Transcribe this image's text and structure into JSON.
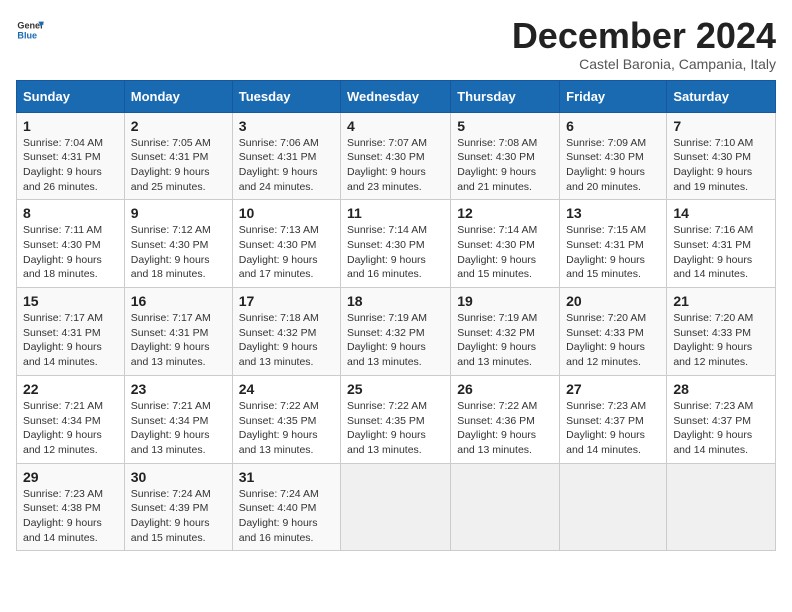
{
  "logo": {
    "line1": "General",
    "line2": "Blue"
  },
  "title": "December 2024",
  "subtitle": "Castel Baronia, Campania, Italy",
  "days_of_week": [
    "Sunday",
    "Monday",
    "Tuesday",
    "Wednesday",
    "Thursday",
    "Friday",
    "Saturday"
  ],
  "weeks": [
    [
      {
        "day": "1",
        "info": "Sunrise: 7:04 AM\nSunset: 4:31 PM\nDaylight: 9 hours\nand 26 minutes."
      },
      {
        "day": "2",
        "info": "Sunrise: 7:05 AM\nSunset: 4:31 PM\nDaylight: 9 hours\nand 25 minutes."
      },
      {
        "day": "3",
        "info": "Sunrise: 7:06 AM\nSunset: 4:31 PM\nDaylight: 9 hours\nand 24 minutes."
      },
      {
        "day": "4",
        "info": "Sunrise: 7:07 AM\nSunset: 4:30 PM\nDaylight: 9 hours\nand 23 minutes."
      },
      {
        "day": "5",
        "info": "Sunrise: 7:08 AM\nSunset: 4:30 PM\nDaylight: 9 hours\nand 21 minutes."
      },
      {
        "day": "6",
        "info": "Sunrise: 7:09 AM\nSunset: 4:30 PM\nDaylight: 9 hours\nand 20 minutes."
      },
      {
        "day": "7",
        "info": "Sunrise: 7:10 AM\nSunset: 4:30 PM\nDaylight: 9 hours\nand 19 minutes."
      }
    ],
    [
      {
        "day": "8",
        "info": "Sunrise: 7:11 AM\nSunset: 4:30 PM\nDaylight: 9 hours\nand 18 minutes."
      },
      {
        "day": "9",
        "info": "Sunrise: 7:12 AM\nSunset: 4:30 PM\nDaylight: 9 hours\nand 18 minutes."
      },
      {
        "day": "10",
        "info": "Sunrise: 7:13 AM\nSunset: 4:30 PM\nDaylight: 9 hours\nand 17 minutes."
      },
      {
        "day": "11",
        "info": "Sunrise: 7:14 AM\nSunset: 4:30 PM\nDaylight: 9 hours\nand 16 minutes."
      },
      {
        "day": "12",
        "info": "Sunrise: 7:14 AM\nSunset: 4:30 PM\nDaylight: 9 hours\nand 15 minutes."
      },
      {
        "day": "13",
        "info": "Sunrise: 7:15 AM\nSunset: 4:31 PM\nDaylight: 9 hours\nand 15 minutes."
      },
      {
        "day": "14",
        "info": "Sunrise: 7:16 AM\nSunset: 4:31 PM\nDaylight: 9 hours\nand 14 minutes."
      }
    ],
    [
      {
        "day": "15",
        "info": "Sunrise: 7:17 AM\nSunset: 4:31 PM\nDaylight: 9 hours\nand 14 minutes."
      },
      {
        "day": "16",
        "info": "Sunrise: 7:17 AM\nSunset: 4:31 PM\nDaylight: 9 hours\nand 13 minutes."
      },
      {
        "day": "17",
        "info": "Sunrise: 7:18 AM\nSunset: 4:32 PM\nDaylight: 9 hours\nand 13 minutes."
      },
      {
        "day": "18",
        "info": "Sunrise: 7:19 AM\nSunset: 4:32 PM\nDaylight: 9 hours\nand 13 minutes."
      },
      {
        "day": "19",
        "info": "Sunrise: 7:19 AM\nSunset: 4:32 PM\nDaylight: 9 hours\nand 13 minutes."
      },
      {
        "day": "20",
        "info": "Sunrise: 7:20 AM\nSunset: 4:33 PM\nDaylight: 9 hours\nand 12 minutes."
      },
      {
        "day": "21",
        "info": "Sunrise: 7:20 AM\nSunset: 4:33 PM\nDaylight: 9 hours\nand 12 minutes."
      }
    ],
    [
      {
        "day": "22",
        "info": "Sunrise: 7:21 AM\nSunset: 4:34 PM\nDaylight: 9 hours\nand 12 minutes."
      },
      {
        "day": "23",
        "info": "Sunrise: 7:21 AM\nSunset: 4:34 PM\nDaylight: 9 hours\nand 13 minutes."
      },
      {
        "day": "24",
        "info": "Sunrise: 7:22 AM\nSunset: 4:35 PM\nDaylight: 9 hours\nand 13 minutes."
      },
      {
        "day": "25",
        "info": "Sunrise: 7:22 AM\nSunset: 4:35 PM\nDaylight: 9 hours\nand 13 minutes."
      },
      {
        "day": "26",
        "info": "Sunrise: 7:22 AM\nSunset: 4:36 PM\nDaylight: 9 hours\nand 13 minutes."
      },
      {
        "day": "27",
        "info": "Sunrise: 7:23 AM\nSunset: 4:37 PM\nDaylight: 9 hours\nand 14 minutes."
      },
      {
        "day": "28",
        "info": "Sunrise: 7:23 AM\nSunset: 4:37 PM\nDaylight: 9 hours\nand 14 minutes."
      }
    ],
    [
      {
        "day": "29",
        "info": "Sunrise: 7:23 AM\nSunset: 4:38 PM\nDaylight: 9 hours\nand 14 minutes."
      },
      {
        "day": "30",
        "info": "Sunrise: 7:24 AM\nSunset: 4:39 PM\nDaylight: 9 hours\nand 15 minutes."
      },
      {
        "day": "31",
        "info": "Sunrise: 7:24 AM\nSunset: 4:40 PM\nDaylight: 9 hours\nand 16 minutes."
      },
      {
        "day": "",
        "info": ""
      },
      {
        "day": "",
        "info": ""
      },
      {
        "day": "",
        "info": ""
      },
      {
        "day": "",
        "info": ""
      }
    ]
  ]
}
